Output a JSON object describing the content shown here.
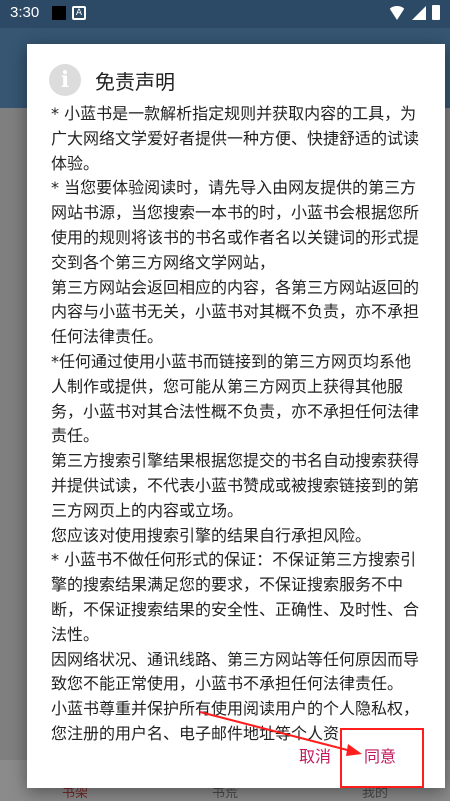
{
  "status_bar": {
    "time": "3:30"
  },
  "dialog": {
    "title": "免责声明",
    "paragraphs": [
      "* 小蓝书是一款解析指定规则并获取内容的工具，为广大网络文学爱好者提供一种方便、快捷舒适的试读体验。",
      "* 当您要体验阅读时，请先导入由网友提供的第三方网站书源，当您搜索一本书的时，小蓝书会根据您所使用的规则将该书的书名或作者名以关键词的形式提交到各个第三方网络文学网站，",
      "第三方网站会返回相应的内容，各第三方网站返回的内容与小蓝书无关，小蓝书对其概不负责，亦不承担任何法律责任。",
      "*任何通过使用小蓝书而链接到的第三方网页均系他人制作或提供，您可能从第三方网页上获得其他服务，小蓝书对其合法性概不负责，亦不承担任何法律责任。",
      "第三方搜索引擎结果根据您提交的书名自动搜索获得并提供试读，不代表小蓝书赞成或被搜索链接到的第三方网页上的内容或立场。",
      "您应该对使用搜索引擎的结果自行承担风险。",
      "* 小蓝书不做任何形式的保证：不保证第三方搜索引擎的搜索结果满足您的要求，不保证搜索服务不中断，不保证搜索结果的安全性、正确性、及时性、合法性。",
      "因网络状况、通讯线路、第三方网站等任何原因而导致您不能正常使用，小蓝书不承担任何法律责任。",
      "小蓝书尊重并保护所有使用阅读用户的个人隐私权，您注册的用户名、电子邮件地址等个人资"
    ],
    "cancel_label": "取消",
    "agree_label": "同意"
  },
  "bottom_nav": {
    "items": [
      "书架",
      "书荒",
      "我的"
    ]
  },
  "colors": {
    "accent": "#c2185b",
    "annotation": "#ff1e1e"
  }
}
